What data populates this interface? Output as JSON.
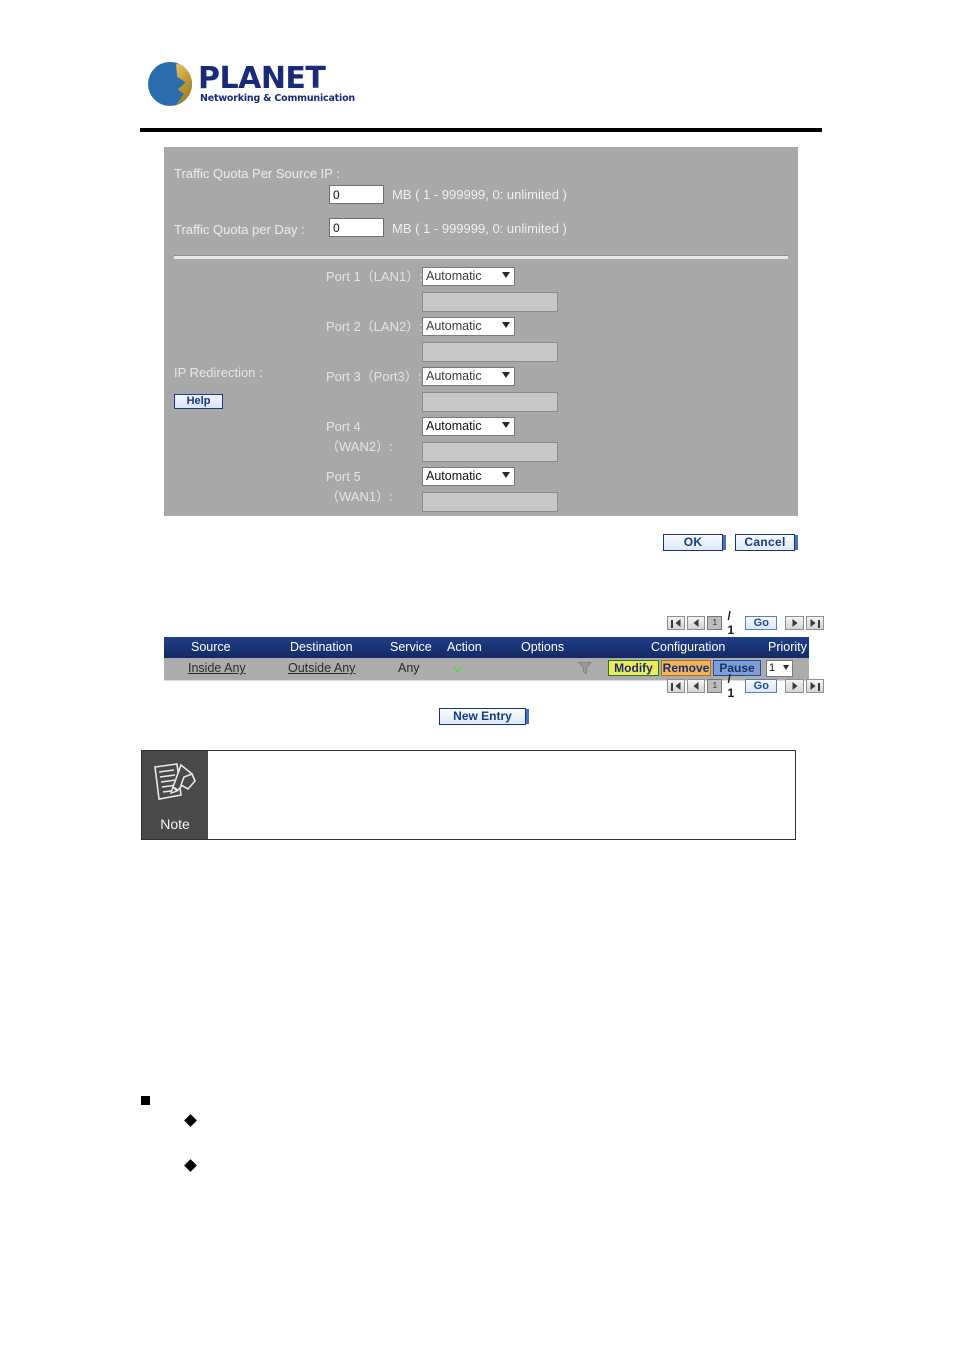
{
  "header": {
    "brand": "PLANET",
    "tagline": "Networking & Communication",
    "logo_icon": "planet-globe-icon"
  },
  "settings_panel": {
    "quota_fields": [
      {
        "label": "Traffic Quota Per Source IP :",
        "value": "0",
        "hint": "MB ( 1 - 999999, 0: unlimited )"
      },
      {
        "label": "Traffic Quota per Day :",
        "value": "0",
        "hint": "MB ( 1 - 999999, 0: unlimited )"
      }
    ],
    "ip_redirection": {
      "label": "IP Redirection :",
      "help_label": "Help",
      "ports": [
        {
          "label": "Port 1（LAN1）:",
          "mode": "Automatic",
          "address": ""
        },
        {
          "label": "Port 2（LAN2）:",
          "mode": "Automatic",
          "address": ""
        },
        {
          "label": "Port 3（Port3）:",
          "mode": "Automatic",
          "address": ""
        },
        {
          "label": "Port 4（WAN2）:",
          "mode": "Automatic",
          "address": ""
        },
        {
          "label": "Port 5（WAN1）:",
          "mode": "Automatic",
          "address": ""
        }
      ]
    }
  },
  "action_buttons": {
    "ok_label": "OK",
    "cancel_label": "Cancel"
  },
  "rule_table": {
    "pager": {
      "page_value": "1",
      "total_label": "/ 1",
      "go_label": "Go",
      "first_icon": "first-page-icon",
      "prev_icon": "previous-page-icon",
      "next_icon": "next-page-icon",
      "last_icon": "last-page-icon"
    },
    "columns": [
      "Source",
      "Destination",
      "Service",
      "Action",
      "Options",
      "Configuration",
      "Priority"
    ],
    "rows": [
      {
        "source": "Inside Any",
        "destination": "Outside Any",
        "service": "Any",
        "action_icon": "green-check-icon",
        "options_icon": "filter-funnel-icon",
        "modify_label": "Modify",
        "remove_label": "Remove",
        "pause_label": "Pause",
        "priority": "1"
      }
    ],
    "new_entry_label": "New Entry"
  },
  "note_box": {
    "label": "Note",
    "icon": "note-pencil-document-icon",
    "body_text": ""
  },
  "bullet_list": {
    "items": [
      {
        "marker": "square",
        "text": ""
      },
      {
        "marker": "diamond",
        "text": ""
      },
      {
        "marker": "diamond",
        "text": ""
      }
    ]
  },
  "colors": {
    "panel_bg": "#a8a8a8",
    "table_header": "#1b3a80",
    "table_row": "#acacac",
    "modify_yellow": "#f2e85c",
    "remove_orange": "#f0b45c",
    "pause_blue": "#7e9fd6",
    "brand_navy": "#1b2a78",
    "button_blue": "#143a86"
  }
}
